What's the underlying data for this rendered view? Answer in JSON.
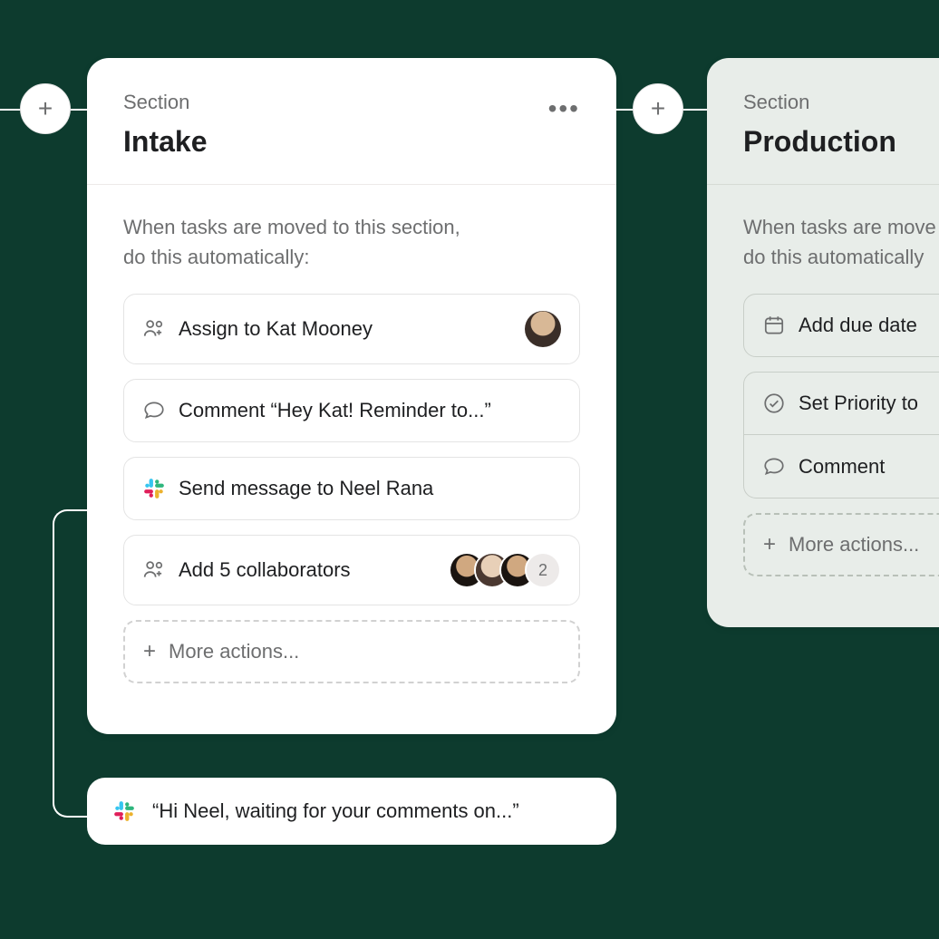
{
  "sections": {
    "intake": {
      "label": "Section",
      "title": "Intake",
      "description_line1": "When tasks are moved to this section,",
      "description_line2": "do this automatically:",
      "actions": {
        "assign": "Assign to Kat Mooney",
        "comment": "Comment “Hey Kat! Reminder to...”",
        "slack": "Send message to Neel Rana",
        "collab": "Add 5 collaborators",
        "collab_more_count": "2",
        "more": "More actions..."
      }
    },
    "production": {
      "label": "Section",
      "title": "Production",
      "description_line1": "When tasks are move",
      "description_line2": "do this automatically",
      "actions": {
        "due": "Add due date",
        "priority": "Set Priority to",
        "comment": "Comment",
        "more": "More actions..."
      }
    }
  },
  "message": {
    "text": "“Hi Neel, waiting for your comments on...”"
  }
}
